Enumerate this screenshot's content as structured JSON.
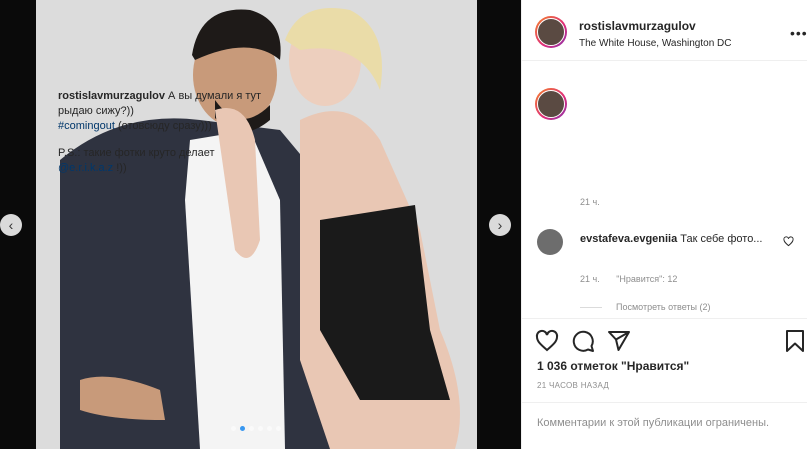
{
  "post": {
    "username": "rostislavmurzagulov",
    "location": "The White House, Washington DC",
    "more_icon": "more-horizontal-icon",
    "carousel": {
      "dot_count": 6,
      "active_dot": 1
    }
  },
  "caption": {
    "username": "rostislavmurzagulov",
    "text1": "А вы думали я тут рыдаю сижу?))",
    "hashtag": "#comingout",
    "text2": "(отовсюду сразу)))",
    "ps_text": "P.S.: такие фотки круто делает",
    "mention": "@e.r.i.k.a.z",
    "ps_end": "!))",
    "time": "21 ч."
  },
  "comment": {
    "username": "evstafeva.evgeniia",
    "text": "Так себе фото...",
    "time": "21 ч.",
    "likes": "\"Нравится\": 12",
    "replies": "Посмотреть ответы (2)"
  },
  "actions": {
    "icons": [
      "heart-icon",
      "comment-icon",
      "share-icon",
      "bookmark-icon"
    ]
  },
  "likes_text": "1 036 отметок \"Нравится\"",
  "posted_ago": "21 ЧАСОВ НАЗАД",
  "comments_disabled": "Комментарии к этой публикации ограничены."
}
